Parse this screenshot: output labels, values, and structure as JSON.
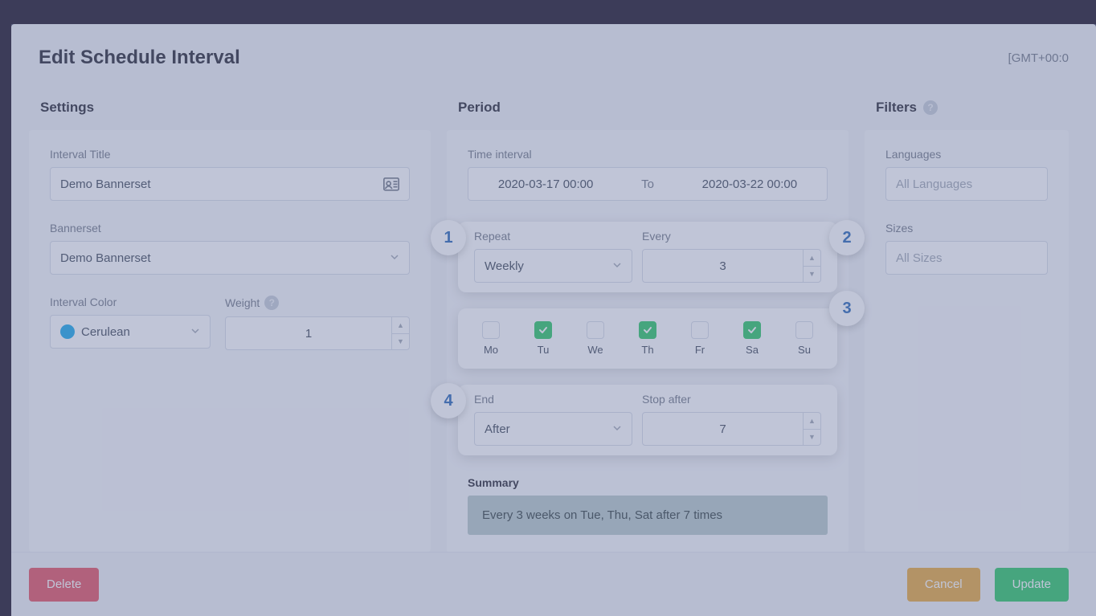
{
  "modal": {
    "title": "Edit Schedule Interval",
    "timezone": "[GMT+00:0"
  },
  "sections": {
    "settings": "Settings",
    "period": "Period",
    "filters": "Filters"
  },
  "settings": {
    "interval_title_label": "Interval Title",
    "interval_title_value": "Demo Bannerset",
    "bannerset_label": "Bannerset",
    "bannerset_value": "Demo Bannerset",
    "interval_color_label": "Interval Color",
    "interval_color_name": "Cerulean",
    "interval_color_hex": "#0ea5e9",
    "weight_label": "Weight",
    "weight_value": "1"
  },
  "period": {
    "time_interval_label": "Time interval",
    "time_from": "2020-03-17 00:00",
    "time_to_label": "To",
    "time_to": "2020-03-22 00:00",
    "repeat_label": "Repeat",
    "repeat_value": "Weekly",
    "every_label": "Every",
    "every_value": "3",
    "days": [
      {
        "code": "Mo",
        "checked": false
      },
      {
        "code": "Tu",
        "checked": true
      },
      {
        "code": "We",
        "checked": false
      },
      {
        "code": "Th",
        "checked": true
      },
      {
        "code": "Fr",
        "checked": false
      },
      {
        "code": "Sa",
        "checked": true
      },
      {
        "code": "Su",
        "checked": false
      }
    ],
    "end_label": "End",
    "end_value": "After",
    "stop_after_label": "Stop after",
    "stop_after_value": "7",
    "summary_label": "Summary",
    "summary_text": "Every 3 weeks on Tue, Thu, Sat after 7 times"
  },
  "filters": {
    "languages_label": "Languages",
    "languages_placeholder": "All Languages",
    "sizes_label": "Sizes",
    "sizes_placeholder": "All Sizes"
  },
  "footer": {
    "delete": "Delete",
    "cancel": "Cancel",
    "update": "Update"
  },
  "callouts": {
    "1": "1",
    "2": "2",
    "3": "3",
    "4": "4"
  }
}
